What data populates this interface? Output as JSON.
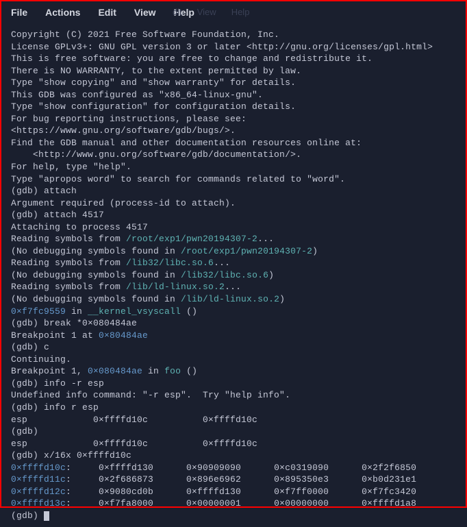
{
  "menubar": {
    "items": [
      {
        "label": "File"
      },
      {
        "label": "Actions"
      },
      {
        "label": "Edit"
      },
      {
        "label": "View"
      },
      {
        "label": "Help"
      }
    ],
    "shadow_items": [
      "dit",
      "View",
      "Help"
    ]
  },
  "terminal": {
    "lines": [
      {
        "segs": [
          {
            "t": "Copyright (C) 2021 Free Software Foundation, Inc."
          }
        ]
      },
      {
        "segs": [
          {
            "t": "License GPLv3+: GNU GPL version 3 or later <http://gnu.org/licenses/gpl.html>"
          }
        ]
      },
      {
        "segs": [
          {
            "t": "This is free software: you are free to change and redistribute it."
          }
        ]
      },
      {
        "segs": [
          {
            "t": "There is NO WARRANTY, to the extent permitted by law."
          }
        ]
      },
      {
        "segs": [
          {
            "t": "Type \"show copying\" and \"show warranty\" for details."
          }
        ]
      },
      {
        "segs": [
          {
            "t": "This GDB was configured as \"x86_64-linux-gnu\"."
          }
        ]
      },
      {
        "segs": [
          {
            "t": "Type \"show configuration\" for configuration details."
          }
        ]
      },
      {
        "segs": [
          {
            "t": "For bug reporting instructions, please see:"
          }
        ]
      },
      {
        "segs": [
          {
            "t": "<https://www.gnu.org/software/gdb/bugs/>."
          }
        ]
      },
      {
        "segs": [
          {
            "t": "Find the GDB manual and other documentation resources online at:"
          }
        ]
      },
      {
        "segs": [
          {
            "t": "    <http://www.gnu.org/software/gdb/documentation/>."
          }
        ]
      },
      {
        "segs": [
          {
            "t": ""
          }
        ]
      },
      {
        "segs": [
          {
            "t": "For help, type \"help\"."
          }
        ]
      },
      {
        "segs": [
          {
            "t": "Type \"apropos word\" to search for commands related to \"word\"."
          }
        ]
      },
      {
        "segs": [
          {
            "t": "(gdb) attach"
          }
        ]
      },
      {
        "segs": [
          {
            "t": "Argument required (process-id to attach)."
          }
        ]
      },
      {
        "segs": [
          {
            "t": "(gdb) attach 4517"
          }
        ]
      },
      {
        "segs": [
          {
            "t": "Attaching to process 4517"
          }
        ]
      },
      {
        "segs": [
          {
            "t": "Reading symbols from "
          },
          {
            "t": "/root/exp1/pwn20194307-2",
            "c": "cyan"
          },
          {
            "t": "..."
          }
        ]
      },
      {
        "segs": [
          {
            "t": "(No debugging symbols found in "
          },
          {
            "t": "/root/exp1/pwn20194307-2",
            "c": "cyan"
          },
          {
            "t": ")"
          }
        ]
      },
      {
        "segs": [
          {
            "t": "Reading symbols from "
          },
          {
            "t": "/lib32/libc.so.6",
            "c": "cyan"
          },
          {
            "t": "..."
          }
        ]
      },
      {
        "segs": [
          {
            "t": "(No debugging symbols found in "
          },
          {
            "t": "/lib32/libc.so.6",
            "c": "cyan"
          },
          {
            "t": ")"
          }
        ]
      },
      {
        "segs": [
          {
            "t": "Reading symbols from "
          },
          {
            "t": "/lib/ld-linux.so.2",
            "c": "cyan"
          },
          {
            "t": "..."
          }
        ]
      },
      {
        "segs": [
          {
            "t": "(No debugging symbols found in "
          },
          {
            "t": "/lib/ld-linux.so.2",
            "c": "cyan"
          },
          {
            "t": ")"
          }
        ]
      },
      {
        "segs": [
          {
            "t": "0×f7fc9559",
            "c": "blue"
          },
          {
            "t": " in "
          },
          {
            "t": "__kernel_vsyscall",
            "c": "cyan"
          },
          {
            "t": " ()"
          }
        ]
      },
      {
        "segs": [
          {
            "t": "(gdb) break *0×080484ae"
          }
        ]
      },
      {
        "segs": [
          {
            "t": "Breakpoint 1 at "
          },
          {
            "t": "0×80484ae",
            "c": "blue"
          }
        ]
      },
      {
        "segs": [
          {
            "t": "(gdb) c"
          }
        ]
      },
      {
        "segs": [
          {
            "t": "Continuing."
          }
        ]
      },
      {
        "segs": [
          {
            "t": ""
          }
        ]
      },
      {
        "segs": [
          {
            "t": "Breakpoint 1, "
          },
          {
            "t": "0×080484ae",
            "c": "blue"
          },
          {
            "t": " in "
          },
          {
            "t": "foo",
            "c": "cyan"
          },
          {
            "t": " ()"
          }
        ]
      },
      {
        "segs": [
          {
            "t": "(gdb) info -r esp"
          }
        ]
      },
      {
        "segs": [
          {
            "t": "Undefined info command: \"-r esp\".  Try \"help info\"."
          }
        ]
      },
      {
        "segs": [
          {
            "t": "(gdb) info r esp"
          }
        ]
      },
      {
        "segs": [
          {
            "t": "esp            0×ffffd10c          0×ffffd10c"
          }
        ]
      },
      {
        "segs": [
          {
            "t": "(gdb) "
          }
        ]
      },
      {
        "segs": [
          {
            "t": "esp            0×ffffd10c          0×ffffd10c"
          }
        ]
      },
      {
        "segs": [
          {
            "t": "(gdb) x/16x 0×ffffd10c"
          }
        ]
      },
      {
        "segs": [
          {
            "t": "0×ffffd10c",
            "c": "blue"
          },
          {
            "t": ":     0×ffffd130      0×90909090      0×c0319090      0×2f2f6850"
          }
        ]
      },
      {
        "segs": [
          {
            "t": "0×ffffd11c",
            "c": "blue"
          },
          {
            "t": ":     0×2f686873      0×896e6962      0×895350e3      0×b0d231e1"
          }
        ]
      },
      {
        "segs": [
          {
            "t": "0×ffffd12c",
            "c": "blue"
          },
          {
            "t": ":     0×9080cd0b      0×ffffd130      0×f7ff0000      0×f7fc3420"
          }
        ]
      },
      {
        "segs": [
          {
            "t": "0×ffffd13c",
            "c": "blue"
          },
          {
            "t": ":     0×f7fa8000      0×00000001      0×00000000      0×ffffd1a8"
          }
        ]
      },
      {
        "segs": [
          {
            "t": "(gdb) "
          }
        ],
        "cursor": true
      }
    ]
  }
}
